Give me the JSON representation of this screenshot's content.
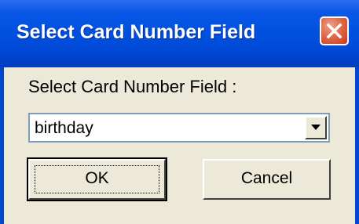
{
  "window": {
    "title": "Select Card Number Field",
    "close_icon": "close-icon",
    "colors": {
      "titlebar": "#0050e0",
      "close_button": "#d9532c",
      "face": "#ece9d8"
    }
  },
  "form": {
    "prompt": "Select Card Number Field :",
    "field_select": {
      "value": "birthday",
      "arrow_icon": "chevron-down-icon"
    }
  },
  "buttons": {
    "ok_label": "OK",
    "cancel_label": "Cancel"
  }
}
